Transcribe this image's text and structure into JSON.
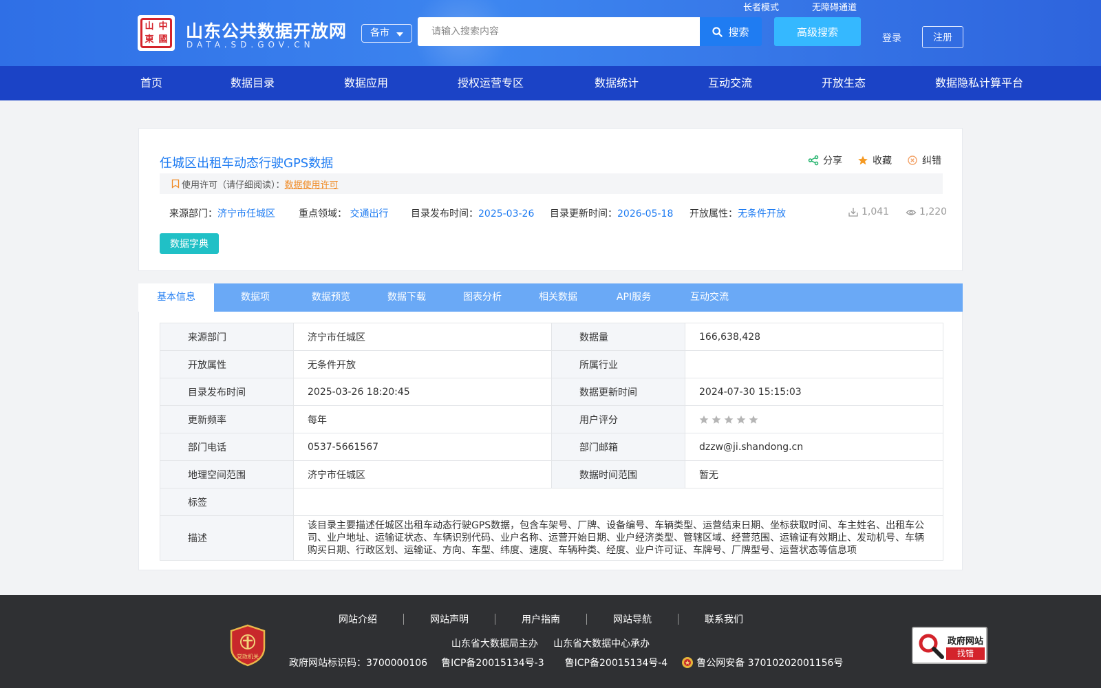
{
  "header": {
    "site_title": "山东公共数据开放网",
    "site_subtitle": "DATA.SD.GOV.CN",
    "seal_chars": [
      "中",
      "國",
      "山",
      "東"
    ],
    "city_select": "各市",
    "search_placeholder": "请输入搜索内容",
    "search_label": "搜索",
    "advanced_search_label": "高级搜索",
    "elder_mode": "长者模式",
    "accessibility": "无障碍通道",
    "login": "登录",
    "register": "注册"
  },
  "nav": {
    "items": [
      "首页",
      "数据目录",
      "数据应用",
      "授权运营专区",
      "数据统计",
      "互动交流",
      "开放生态",
      "数据隐私计算平台"
    ]
  },
  "dataset": {
    "title": "任城区出租车动态行驶GPS数据",
    "actions": {
      "share": "分享",
      "favorite": "收藏",
      "report": "纠错"
    },
    "license_label": "使用许可（请仔细阅读）：",
    "license_link": "数据使用许可",
    "meta": {
      "source_label": "来源部门：",
      "source_value": "济宁市任城区",
      "domain_label": "重点领域：",
      "domain_value": "交通出行",
      "publish_label": "目录发布时间：",
      "publish_value": "2025-03-26",
      "update_label": "目录更新时间：",
      "update_value": "2026-05-18",
      "open_label": "开放属性：",
      "open_value": "无条件开放"
    },
    "downloads": "1,041",
    "views": "1,220",
    "dict_button": "数据字典"
  },
  "tabs": [
    "基本信息",
    "数据项",
    "数据预览",
    "数据下载",
    "图表分析",
    "相关数据",
    "API服务",
    "互动交流"
  ],
  "info": {
    "rows": [
      [
        "来源部门",
        "济宁市任城区",
        "数据量",
        "166,638,428"
      ],
      [
        "开放属性",
        "无条件开放",
        "所属行业",
        ""
      ],
      [
        "目录发布时间",
        "2025-03-26 18:20:45",
        "数据更新时间",
        "2024-07-30 15:15:03"
      ],
      [
        "更新频率",
        "每年",
        "用户评分",
        ""
      ],
      [
        "部门电话",
        "0537-5661567",
        "部门邮箱",
        "dzzw@ji.shandong.cn"
      ],
      [
        "地理空间范围",
        "济宁市任城区",
        "数据时间范围",
        "暂无"
      ]
    ],
    "rating": 0,
    "rating_max": 5,
    "tag_label": "标签",
    "tag_value": "",
    "desc_label": "描述",
    "desc_value": "该目录主要描述任城区出租车动态行驶GPS数据，包含车架号、厂牌、设备编号、车辆类型、运营结束日期、坐标获取时间、车主姓名、出租车公司、业户地址、运输证状态、车辆识别代码、业户名称、运营开始日期、业户经济类型、管辖区域、经营范围、运输证有效期止、发动机号、车辆购买日期、行政区划、运输证、方向、车型、纬度、速度、车辆种类、经度、业户许可证、车牌号、厂牌型号、运营状态等信息项"
  },
  "footer": {
    "links": [
      "网站介绍",
      "网站声明",
      "用户指南",
      "网站导航",
      "联系我们"
    ],
    "host": "山东省大数据局主办",
    "organizer": "山东省大数据中心承办",
    "site_code": "政府网站标识码：3700000106",
    "icp1": "鲁ICP备20015134号-3",
    "icp2": "鲁ICP备20015134号-4",
    "police": "鲁公网安备 37010202001156号",
    "party_badge": "党政机关",
    "gov_badge_title": "政府网站",
    "gov_badge_action": "找错"
  },
  "colors": {
    "brand_blue": "#1f7cf2",
    "nav_blue": "#1b43c6",
    "accent_orange": "#f08a24",
    "teal": "#20c0c6"
  }
}
